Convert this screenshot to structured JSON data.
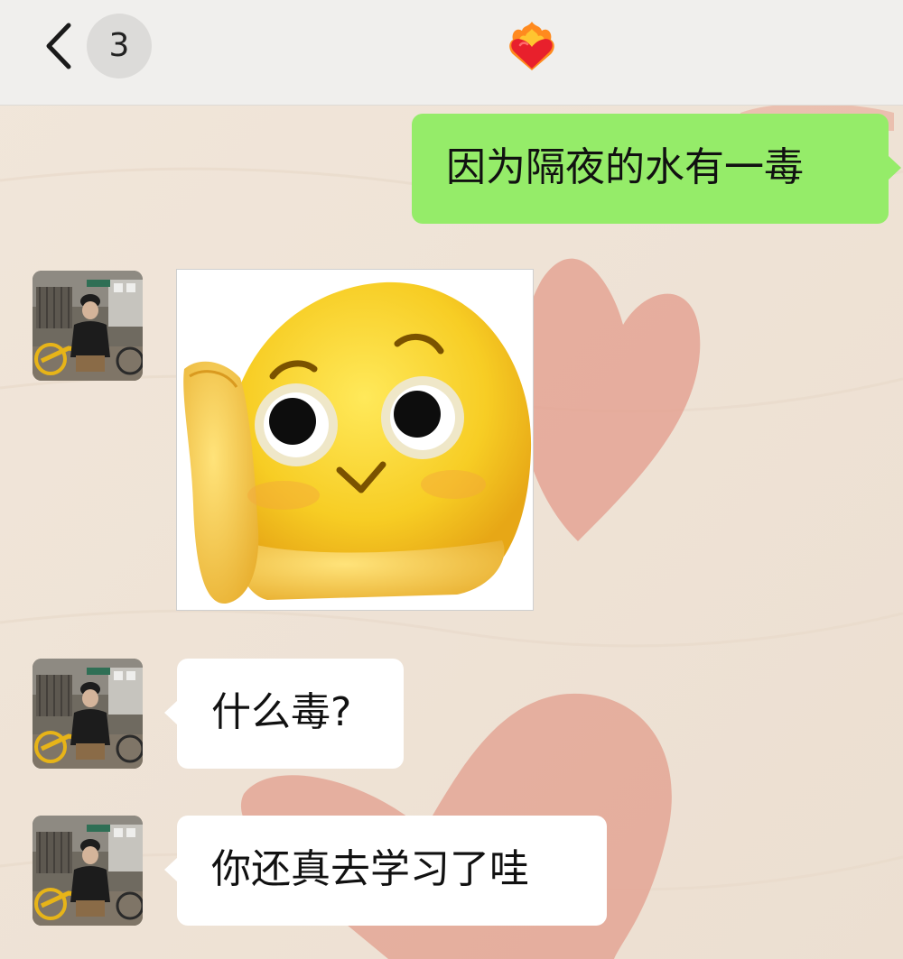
{
  "header": {
    "back_icon": "chevron-left-icon",
    "unread_count": "3",
    "title_icon": "heart-on-fire-icon"
  },
  "messages": [
    {
      "direction": "outgoing",
      "type": "text",
      "text": "因为隔夜的水有一毒"
    },
    {
      "direction": "incoming",
      "type": "sticker",
      "sticker": "blushing-peeking-emoji"
    },
    {
      "direction": "incoming",
      "type": "text",
      "text": "什么毒?"
    },
    {
      "direction": "incoming",
      "type": "text",
      "text": "你还真去学习了哇"
    }
  ],
  "colors": {
    "outgoing_bubble": "#95ec69",
    "incoming_bubble": "#ffffff",
    "top_bar": "#f0efed",
    "chat_background": "#efe3d6",
    "wallpaper_heart": "#e3a090"
  }
}
